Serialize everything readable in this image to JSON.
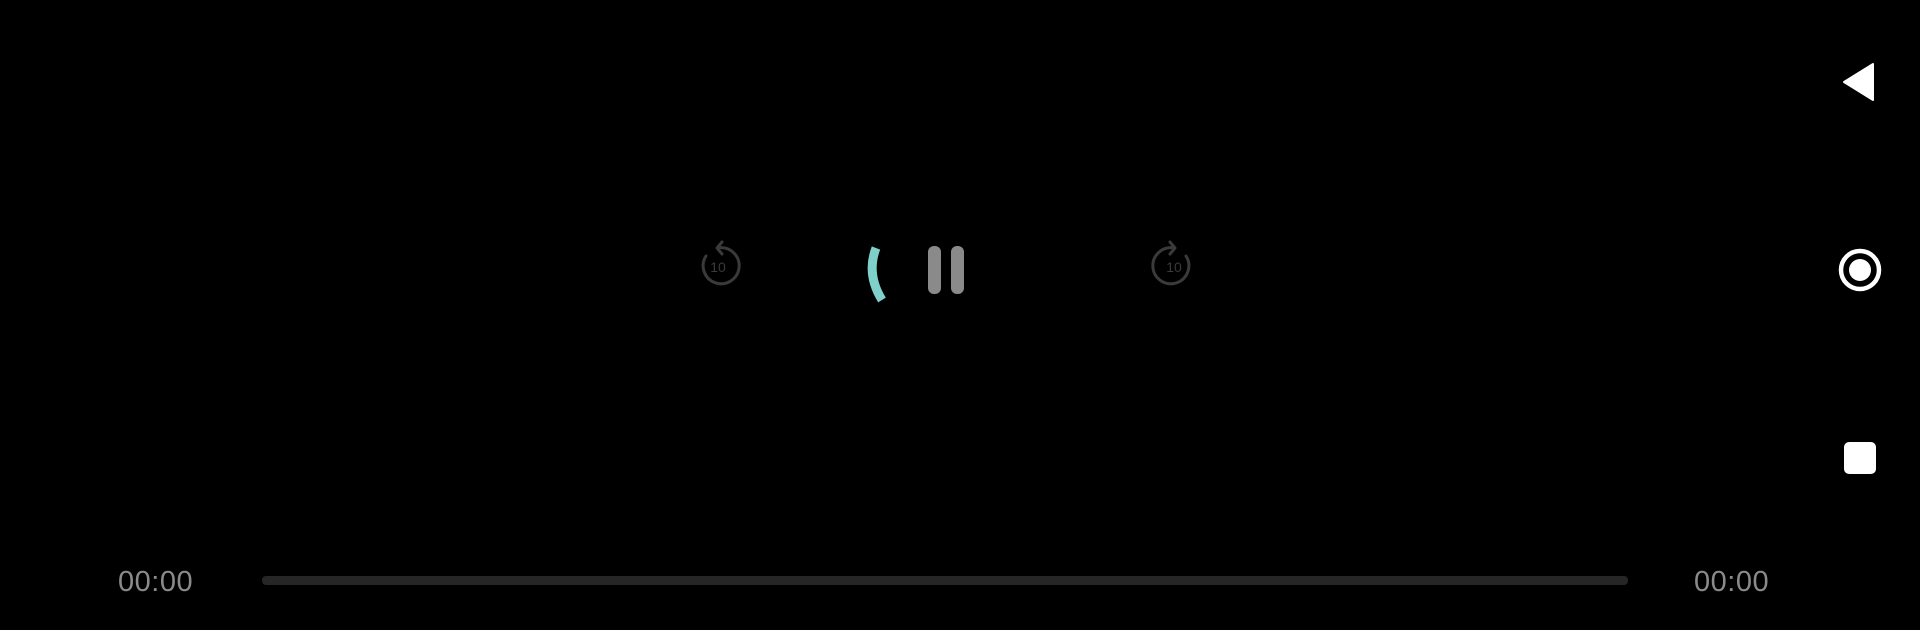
{
  "player": {
    "time_current": "00:00",
    "time_total": "00:00",
    "progress": 0,
    "rewind_seconds": "10",
    "forward_seconds": "10",
    "state": "buffering"
  },
  "icons": {
    "rewind": "replay-10-icon",
    "forward": "forward-10-icon",
    "pause": "pause-icon",
    "spinner": "loading-spinner-icon",
    "back": "nav-back-icon",
    "home": "nav-home-icon",
    "recents": "nav-recents-icon"
  },
  "colors": {
    "background": "#000000",
    "accent": "#7fcfca",
    "control": "#8a8a8a",
    "control_dim": "#3a3a3a",
    "track": "#262626",
    "nav": "#ffffff"
  }
}
